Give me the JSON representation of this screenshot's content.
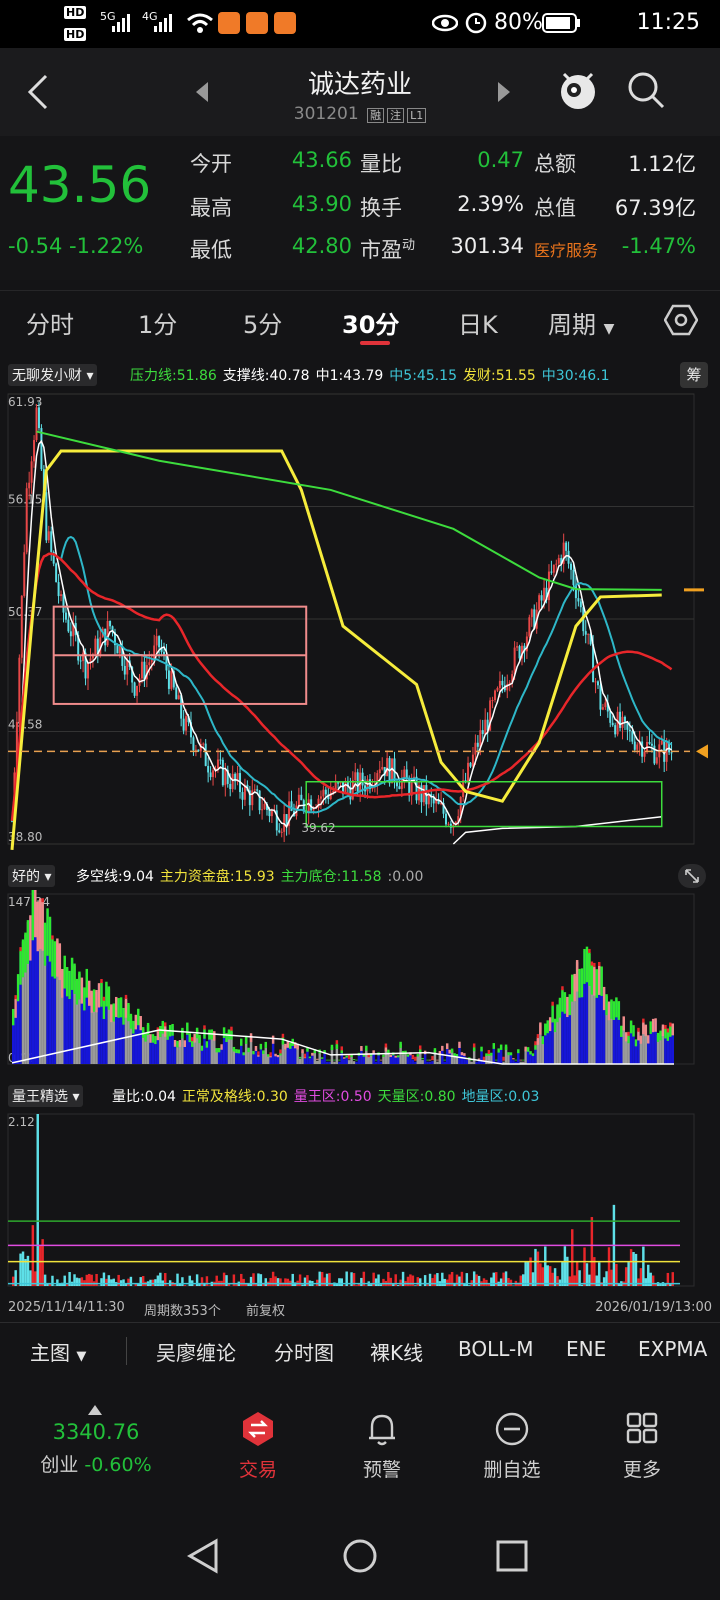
{
  "status": {
    "time": "11:25",
    "battery": "80%",
    "net1": "5G",
    "net2": "4G",
    "hd1": "HD",
    "hd2": "HD"
  },
  "header": {
    "name": "诚达药业",
    "code": "301201",
    "tag1": "融",
    "tag2": "注",
    "tag3": "L1"
  },
  "quote": {
    "price": "43.56",
    "change": "-0.54",
    "change_pct": "-1.22%",
    "rows": [
      {
        "l1": "今开",
        "v1": "43.66",
        "l2": "量比",
        "v2": "0.47",
        "l3": "总额",
        "v3": "1.12亿"
      },
      {
        "l1": "最高",
        "v1": "43.90",
        "l2": "换手",
        "v2": "2.39%",
        "l3": "总值",
        "v3": "67.39亿"
      },
      {
        "l1": "最低",
        "v1": "42.80",
        "l2": "市盈",
        "l2sup": "动",
        "v2": "301.34",
        "l3": "医疗服务",
        "v3": "-1.47%"
      }
    ]
  },
  "tabs": [
    "分时",
    "1分",
    "5分",
    "30分",
    "日K",
    "周期"
  ],
  "main_chart": {
    "indicator": "无聊发小财",
    "labels": [
      {
        "text": "压力线:51.86",
        "color": "#3ddc3d"
      },
      {
        "text": "支撑线:40.78",
        "color": "#ffffff"
      },
      {
        "text": "中1:43.79",
        "color": "#ffffff"
      },
      {
        "text": "中5:45.15",
        "color": "#3ec6d8"
      },
      {
        "text": "发财:51.55",
        "color": "#f1e33c"
      },
      {
        "text": "中30:46.1",
        "color": "#3ec6d8"
      }
    ],
    "chip_button": "筹",
    "y_ticks": [
      "61.93",
      "56.15",
      "50.37",
      "44.58",
      "38.80"
    ],
    "low_marker": "39.62",
    "ylim": [
      38.8,
      61.93
    ],
    "current": 43.56
  },
  "sub1": {
    "indicator": "好的",
    "labels": [
      {
        "text": "多空线:9.04",
        "color": "#ffffff"
      },
      {
        "text": "主力资金盘:15.93",
        "color": "#f1e33c"
      },
      {
        "text": "主力底仓:11.58",
        "color": "#3ddc3d"
      },
      {
        "text": ":0.00",
        "color": "#aaaaaa"
      }
    ],
    "y_ticks": [
      "147.34",
      "0.00"
    ]
  },
  "sub2": {
    "indicator": "量王精选",
    "labels": [
      {
        "text": "量比:0.04",
        "color": "#ffffff"
      },
      {
        "text": "正常及格线:0.30",
        "color": "#f1e33c"
      },
      {
        "text": "量王区:0.50",
        "color": "#e04ce0"
      },
      {
        "text": "天量区:0.80",
        "color": "#3ddc3d"
      },
      {
        "text": "地量区:0.03",
        "color": "#3ec6d8"
      }
    ],
    "y_ticks": [
      "2.12"
    ]
  },
  "footer_axis": {
    "start": "2025/11/14/11:30",
    "periods": "周期数353个",
    "adjust": "前复权",
    "end": "2026/01/19/13:00"
  },
  "toolbar": [
    "主图",
    "吴廖缠论",
    "分时图",
    "裸K线",
    "BOLL-M",
    "ENE",
    "EXPMA"
  ],
  "bottom_nav": {
    "index_value": "3340.76",
    "index_name": "创业",
    "index_change": "-0.60%",
    "items": [
      "交易",
      "预警",
      "删自选",
      "更多"
    ]
  },
  "colors": {
    "up": "#e03a3a",
    "down": "#22c03a",
    "accent": "#e0333a",
    "bg": "#141416"
  }
}
